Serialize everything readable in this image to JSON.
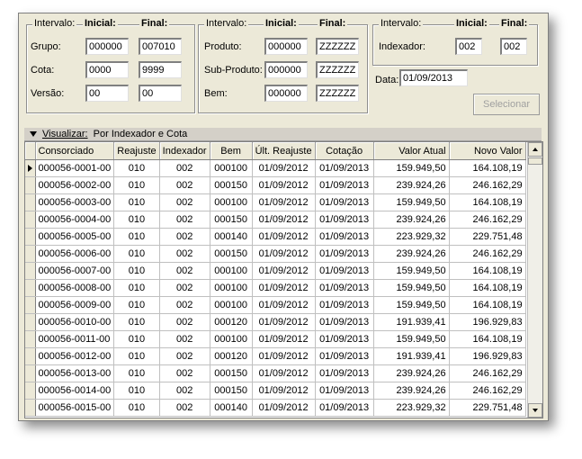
{
  "filters": {
    "intervalo_label": "Intervalo:",
    "inicial_label": "Inicial:",
    "final_label": "Final:",
    "group1": {
      "rows": [
        {
          "label": "Grupo:",
          "inicial": "000000",
          "final": "007010"
        },
        {
          "label": "Cota:",
          "inicial": "0000",
          "final": "9999"
        },
        {
          "label": "Versão:",
          "inicial": "00",
          "final": "00"
        }
      ]
    },
    "group2": {
      "rows": [
        {
          "label": "Produto:",
          "inicial": "000000",
          "final": "ZZZZZZ"
        },
        {
          "label": "Sub-Produto:",
          "inicial": "000000",
          "final": "ZZZZZZ"
        },
        {
          "label": "Bem:",
          "inicial": "000000",
          "final": "ZZZZZZ"
        }
      ]
    },
    "group3": {
      "label": "Indexador:",
      "inicial": "002",
      "final": "002"
    },
    "data_label": "Data:",
    "data_value": "01/09/2013",
    "selecionar_label": "Selecionar"
  },
  "visualizar": {
    "label": "Visualizar:",
    "value": "Por Indexador e Cota"
  },
  "table": {
    "columns": [
      "Consorciado",
      "Reajuste",
      "Indexador",
      "Bem",
      "Últ. Reajuste",
      "Cotação",
      "Valor Atual",
      "Novo Valor"
    ],
    "rows": [
      [
        "000056-0001-00",
        "010",
        "002",
        "000100",
        "01/09/2012",
        "01/09/2013",
        "159.949,50",
        "164.108,19"
      ],
      [
        "000056-0002-00",
        "010",
        "002",
        "000150",
        "01/09/2012",
        "01/09/2013",
        "239.924,26",
        "246.162,29"
      ],
      [
        "000056-0003-00",
        "010",
        "002",
        "000100",
        "01/09/2012",
        "01/09/2013",
        "159.949,50",
        "164.108,19"
      ],
      [
        "000056-0004-00",
        "010",
        "002",
        "000150",
        "01/09/2012",
        "01/09/2013",
        "239.924,26",
        "246.162,29"
      ],
      [
        "000056-0005-00",
        "010",
        "002",
        "000140",
        "01/09/2012",
        "01/09/2013",
        "223.929,32",
        "229.751,48"
      ],
      [
        "000056-0006-00",
        "010",
        "002",
        "000150",
        "01/09/2012",
        "01/09/2013",
        "239.924,26",
        "246.162,29"
      ],
      [
        "000056-0007-00",
        "010",
        "002",
        "000100",
        "01/09/2012",
        "01/09/2013",
        "159.949,50",
        "164.108,19"
      ],
      [
        "000056-0008-00",
        "010",
        "002",
        "000100",
        "01/09/2012",
        "01/09/2013",
        "159.949,50",
        "164.108,19"
      ],
      [
        "000056-0009-00",
        "010",
        "002",
        "000100",
        "01/09/2012",
        "01/09/2013",
        "159.949,50",
        "164.108,19"
      ],
      [
        "000056-0010-00",
        "010",
        "002",
        "000120",
        "01/09/2012",
        "01/09/2013",
        "191.939,41",
        "196.929,83"
      ],
      [
        "000056-0011-00",
        "010",
        "002",
        "000100",
        "01/09/2012",
        "01/09/2013",
        "159.949,50",
        "164.108,19"
      ],
      [
        "000056-0012-00",
        "010",
        "002",
        "000120",
        "01/09/2012",
        "01/09/2013",
        "191.939,41",
        "196.929,83"
      ],
      [
        "000056-0013-00",
        "010",
        "002",
        "000150",
        "01/09/2012",
        "01/09/2013",
        "239.924,26",
        "246.162,29"
      ],
      [
        "000056-0014-00",
        "010",
        "002",
        "000150",
        "01/09/2012",
        "01/09/2013",
        "239.924,26",
        "246.162,29"
      ],
      [
        "000056-0015-00",
        "010",
        "002",
        "000140",
        "01/09/2012",
        "01/09/2013",
        "223.929,32",
        "229.751,48"
      ]
    ]
  },
  "icons": {
    "row_pointer": "triangle-right-icon",
    "visualizar_toggle": "triangle-down-icon",
    "scroll_up": "arrow-up-icon",
    "scroll_down": "arrow-down-icon"
  },
  "colors": {
    "panel": "#ece9d8",
    "disabled_text": "#a0a0a0"
  }
}
